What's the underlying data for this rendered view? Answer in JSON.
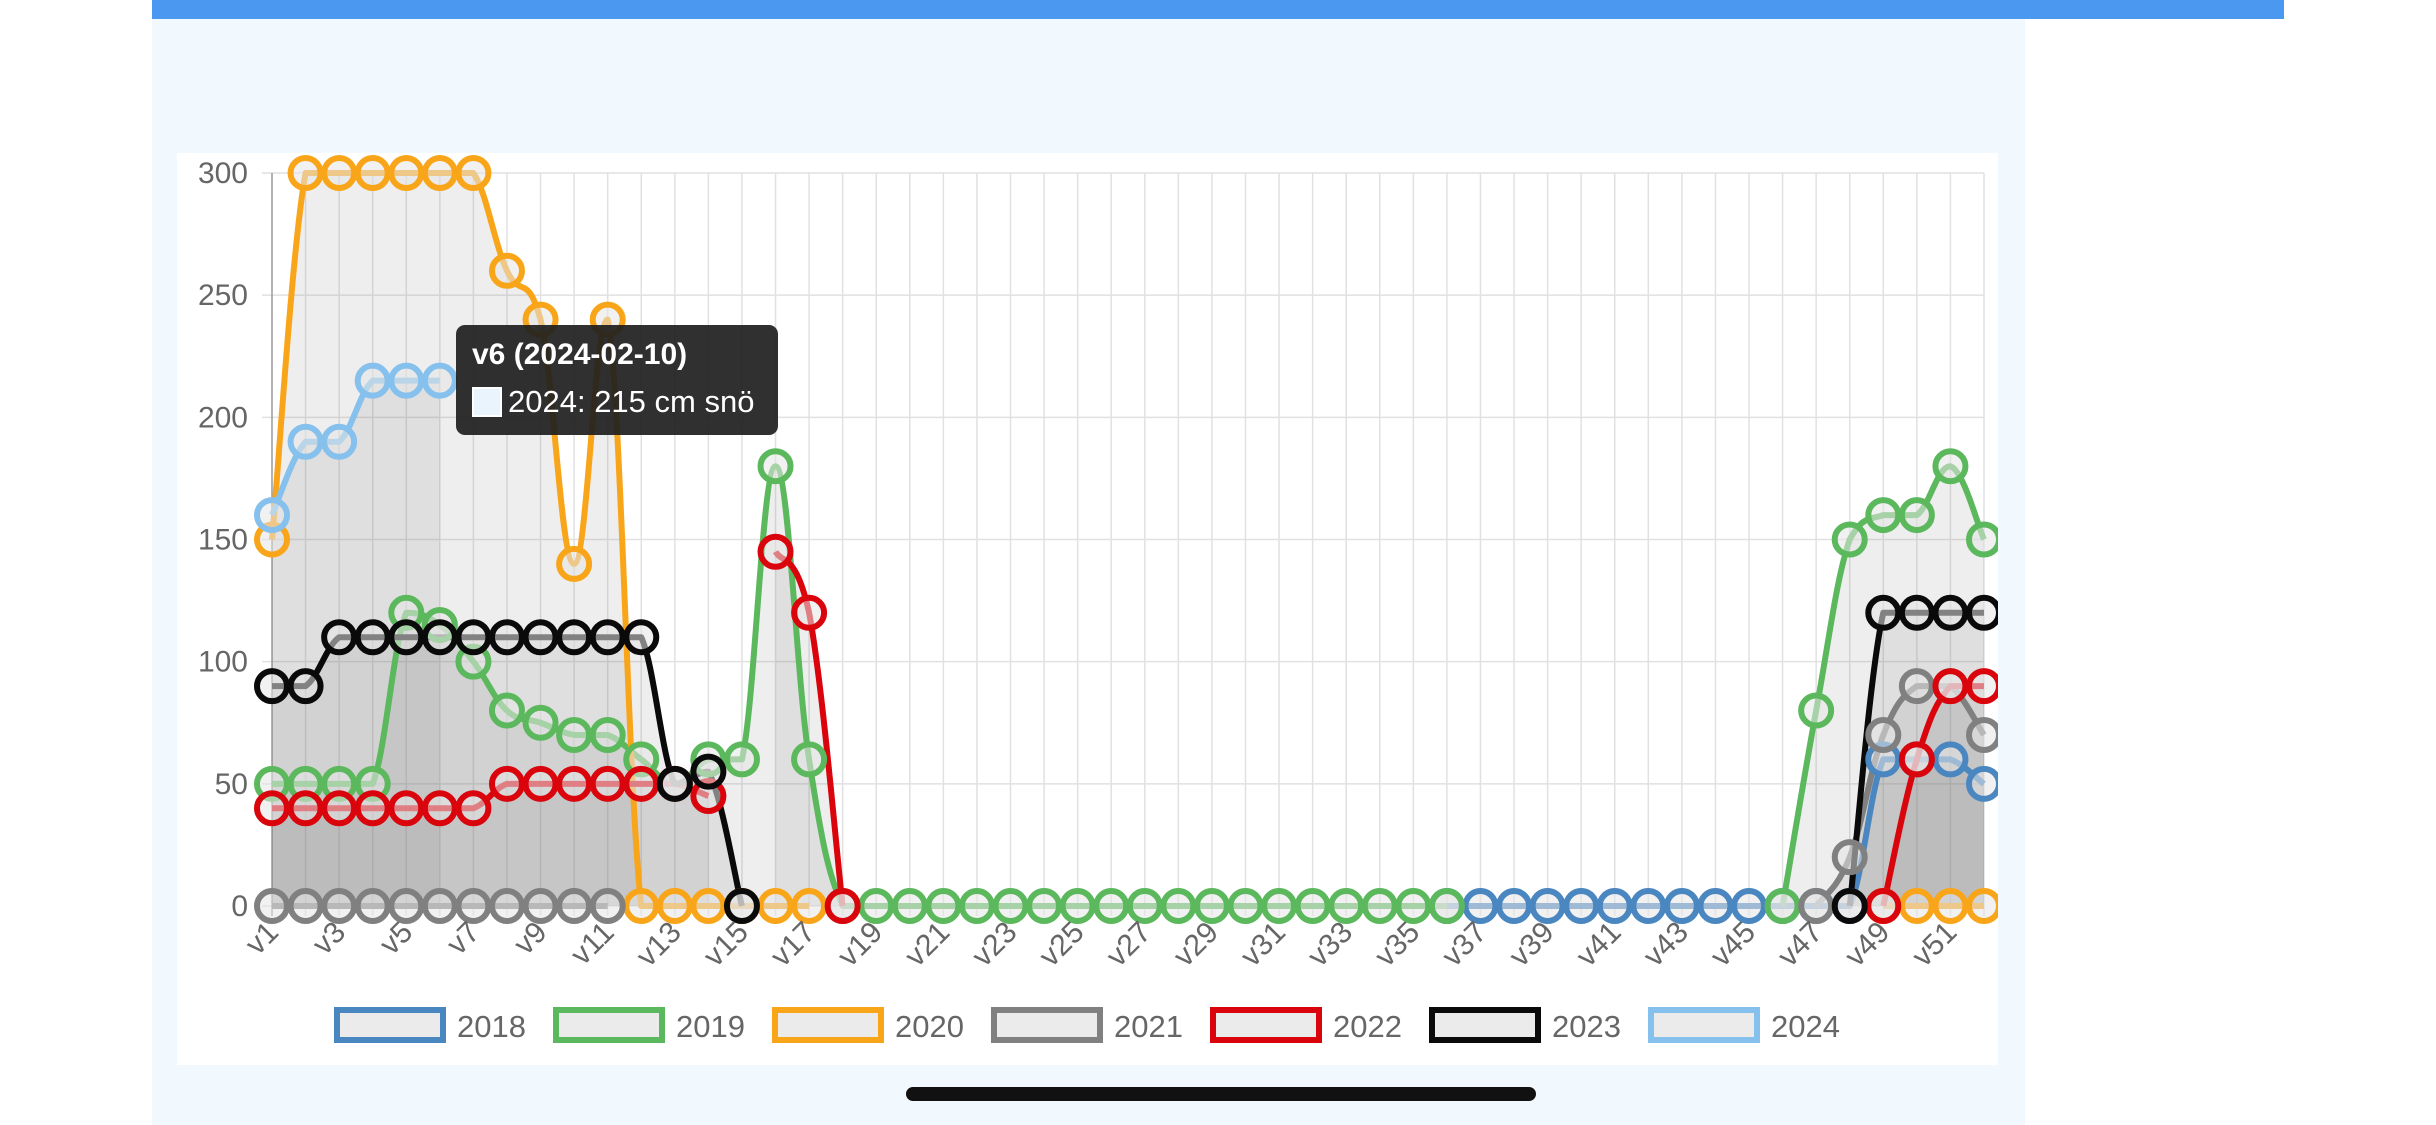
{
  "tooltip": {
    "title": "v6 (2024-02-10)",
    "body": "2024: 215 cm snö"
  },
  "chart_data": {
    "type": "line",
    "categories": [
      "v1",
      "v2",
      "v3",
      "v4",
      "v5",
      "v6",
      "v7",
      "v8",
      "v9",
      "v10",
      "v11",
      "v12",
      "v13",
      "v14",
      "v15",
      "v16",
      "v17",
      "v18",
      "v19",
      "v20",
      "v21",
      "v22",
      "v23",
      "v24",
      "v25",
      "v26",
      "v27",
      "v28",
      "v29",
      "v30",
      "v31",
      "v32",
      "v33",
      "v34",
      "v35",
      "v36",
      "v37",
      "v38",
      "v39",
      "v40",
      "v41",
      "v42",
      "v43",
      "v44",
      "v45",
      "v46",
      "v47",
      "v48",
      "v49",
      "v50",
      "v51",
      "v52"
    ],
    "x_tick_labels": [
      "v1",
      "v3",
      "v5",
      "v7",
      "v9",
      "v11",
      "v13",
      "v15",
      "v17",
      "v19",
      "v21",
      "v23",
      "v25",
      "v27",
      "v29",
      "v31",
      "v33",
      "v35",
      "v37",
      "v39",
      "v41",
      "v43",
      "v45",
      "v47",
      "v49",
      "v51"
    ],
    "y_ticks": [
      0,
      50,
      100,
      150,
      200,
      250,
      300
    ],
    "ylim": [
      0,
      300
    ],
    "grid": true,
    "legend_position": "bottom",
    "series": [
      {
        "name": "2018",
        "color": "#4a86c0",
        "values": [
          null,
          null,
          null,
          null,
          null,
          null,
          null,
          null,
          null,
          null,
          null,
          null,
          null,
          null,
          null,
          null,
          null,
          null,
          null,
          null,
          null,
          null,
          null,
          null,
          null,
          null,
          null,
          null,
          null,
          null,
          null,
          null,
          null,
          null,
          null,
          0,
          0,
          0,
          0,
          0,
          0,
          0,
          0,
          0,
          0,
          0,
          0,
          0,
          60,
          60,
          60,
          50
        ]
      },
      {
        "name": "2019",
        "color": "#5cb85c",
        "values": [
          50,
          50,
          50,
          50,
          120,
          115,
          100,
          80,
          75,
          70,
          70,
          60,
          50,
          60,
          60,
          180,
          60,
          0,
          0,
          0,
          0,
          0,
          0,
          0,
          0,
          0,
          0,
          0,
          0,
          0,
          0,
          0,
          0,
          0,
          0,
          0,
          null,
          null,
          null,
          null,
          null,
          null,
          null,
          null,
          null,
          0,
          80,
          150,
          160,
          160,
          180,
          150
        ]
      },
      {
        "name": "2020",
        "color": "#f9a51a",
        "values": [
          150,
          300,
          300,
          300,
          300,
          300,
          300,
          260,
          240,
          140,
          240,
          0,
          0,
          0,
          0,
          0,
          0,
          null,
          null,
          null,
          null,
          null,
          null,
          null,
          null,
          null,
          null,
          null,
          null,
          null,
          null,
          null,
          null,
          null,
          null,
          null,
          null,
          null,
          null,
          null,
          null,
          null,
          null,
          null,
          null,
          null,
          null,
          null,
          0,
          0,
          0,
          0
        ]
      },
      {
        "name": "2021",
        "color": "#808080",
        "values": [
          0,
          0,
          0,
          0,
          0,
          0,
          0,
          0,
          0,
          0,
          0,
          null,
          null,
          null,
          null,
          null,
          null,
          null,
          null,
          null,
          null,
          null,
          null,
          null,
          null,
          null,
          null,
          null,
          null,
          null,
          null,
          null,
          null,
          null,
          null,
          null,
          null,
          null,
          null,
          null,
          null,
          null,
          null,
          null,
          null,
          null,
          0,
          20,
          70,
          90,
          90,
          70
        ]
      },
      {
        "name": "2022",
        "color": "#d9040c",
        "values": [
          40,
          40,
          40,
          40,
          40,
          40,
          40,
          50,
          50,
          50,
          50,
          50,
          50,
          45,
          null,
          145,
          120,
          0,
          null,
          null,
          null,
          null,
          null,
          null,
          null,
          null,
          null,
          null,
          null,
          null,
          null,
          null,
          null,
          null,
          null,
          null,
          null,
          null,
          null,
          null,
          null,
          null,
          null,
          null,
          null,
          null,
          null,
          null,
          0,
          60,
          90,
          90
        ]
      },
      {
        "name": "2023",
        "color": "#0a0a0a",
        "values": [
          90,
          90,
          110,
          110,
          110,
          110,
          110,
          110,
          110,
          110,
          110,
          110,
          50,
          55,
          0,
          null,
          null,
          null,
          null,
          null,
          null,
          null,
          null,
          null,
          null,
          null,
          null,
          null,
          null,
          null,
          null,
          null,
          null,
          null,
          null,
          null,
          null,
          null,
          null,
          null,
          null,
          null,
          null,
          null,
          null,
          null,
          null,
          0,
          120,
          120,
          120,
          120
        ]
      },
      {
        "name": "2024",
        "color": "#86c0ec",
        "values": [
          160,
          190,
          190,
          215,
          215,
          215,
          null,
          null,
          null,
          null,
          null,
          null,
          null,
          null,
          null,
          null,
          null,
          null,
          null,
          null,
          null,
          null,
          null,
          null,
          null,
          null,
          null,
          null,
          null,
          null,
          null,
          null,
          null,
          null,
          null,
          null,
          null,
          null,
          null,
          null,
          null,
          null,
          null,
          null,
          null,
          null,
          null,
          null,
          null,
          null,
          null,
          null
        ]
      }
    ]
  }
}
